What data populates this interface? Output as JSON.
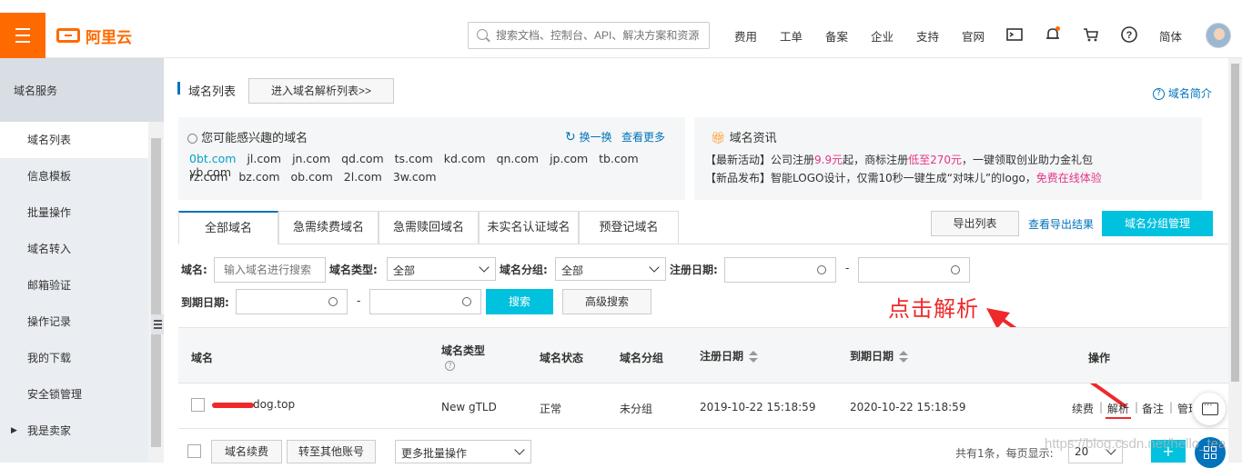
{
  "header": {
    "logo_text": "阿里云",
    "search_placeholder": "搜索文档、控制台、API、解决方案和资源",
    "nav": [
      "费用",
      "工单",
      "备案",
      "企业",
      "支持",
      "官网"
    ],
    "lang": "简体"
  },
  "sidebar": {
    "title": "域名服务",
    "items": [
      {
        "label": "域名列表"
      },
      {
        "label": "信息模板"
      },
      {
        "label": "批量操作"
      },
      {
        "label": "域名转入"
      },
      {
        "label": "邮箱验证"
      },
      {
        "label": "操作记录"
      },
      {
        "label": "我的下载"
      },
      {
        "label": "安全锁管理"
      },
      {
        "label": "我是卖家"
      }
    ]
  },
  "page": {
    "title": "域名列表",
    "enter_dns_button": "进入域名解析列表>>",
    "intro_link": "域名简介"
  },
  "suggest": {
    "title": "您可能感兴趣的域名",
    "refresh": "换一换",
    "more": "查看更多",
    "highlight": "0bt.com",
    "row1": [
      "jl.com",
      "jn.com",
      "qd.com",
      "ts.com",
      "kd.com",
      "qn.com",
      "jp.com",
      "tb.com",
      "yb.com"
    ],
    "row2": [
      "rz.com",
      "bz.com",
      "ob.com",
      "2l.com",
      "3w.com"
    ]
  },
  "news": {
    "title": "域名资讯",
    "line1_a": "【最新活动】公司注册",
    "line1_b": "9.9元",
    "line1_c": "起，商标注册",
    "line1_d": "低至270元",
    "line1_e": "，一键领取创业助力金礼包",
    "line2_a": "【新品发布】智能LOGO设计，仅需10秒一键生成“对味儿”的logo，",
    "line2_b": "免费在线体验"
  },
  "tabs": [
    "全部域名",
    "急需续费域名",
    "急需赎回域名",
    "未实名认证域名",
    "预登记域名"
  ],
  "actions": {
    "export": "导出列表",
    "export_results": "查看导出结果",
    "group_manage": "域名分组管理"
  },
  "filters": {
    "domain_label": "域名:",
    "domain_placeholder": "输入域名进行搜索",
    "type_label": "域名类型:",
    "type_value": "全部",
    "group_label": "域名分组:",
    "group_value": "全部",
    "reg_label": "注册日期:",
    "dash": "-",
    "exp_label": "到期日期:",
    "search_button": "搜索",
    "advanced_button": "高级搜索"
  },
  "annotation": {
    "text": "点击解析",
    "color": "#ee2929"
  },
  "table": {
    "headers": {
      "domain": "域名",
      "type": "域名类型",
      "status": "域名状态",
      "group": "域名分组",
      "reg": "注册日期",
      "exp": "到期日期",
      "ops": "操作"
    },
    "row": {
      "domain_suffix": "dog.top",
      "type": "New gTLD",
      "status": "正常",
      "group": "未分组",
      "reg": "2019-10-22 15:18:59",
      "exp": "2020-10-22 15:18:59",
      "op_renew": "续费",
      "op_resolve": "解析",
      "op_note": "备注",
      "op_manage": "管理",
      "sep": "|"
    }
  },
  "footer": {
    "renew_button": "域名续费",
    "transfer_button": "转至其他账号",
    "batch_select": "更多批量操作",
    "summary": "共有1条，每页显示:",
    "page_size": "20"
  },
  "watermark": "https://blog.csdn.net/hello_tea"
}
